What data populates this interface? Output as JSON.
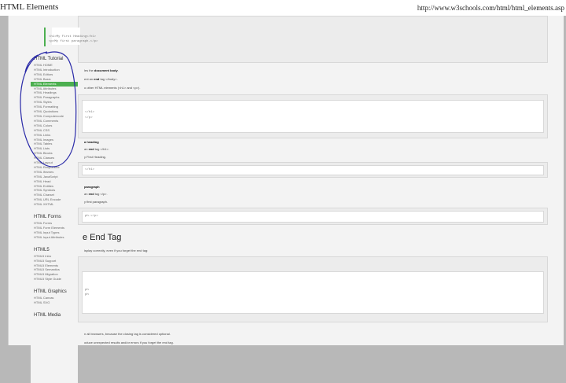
{
  "window": {
    "title": "HTML Elements",
    "url": "http://www.w3schools.com/html/html_elements.asp"
  },
  "sidebar": {
    "sections": [
      {
        "title": "HTML Tutorial",
        "items": [
          "HTML HOME",
          "HTML Introduction",
          "HTML Editors",
          "HTML Basic",
          "HTML Elements",
          "HTML Attributes",
          "HTML Headings",
          "HTML Paragraphs",
          "HTML Styles",
          "HTML Formatting",
          "HTML Quotations",
          "HTML Computercode",
          "HTML Comments",
          "HTML Colors",
          "HTML CSS",
          "HTML Links",
          "HTML Images",
          "HTML Tables",
          "HTML Lists",
          "HTML Blocks",
          "HTML Classes",
          "HTML Layout",
          "HTML Responsive",
          "HTML Iframes",
          "HTML JavaScript",
          "HTML Head",
          "HTML Entities",
          "HTML Symbols",
          "HTML Charset",
          "HTML URL Encode",
          "HTML XHTML"
        ]
      },
      {
        "title": "HTML Forms",
        "items": [
          "HTML Forms",
          "HTML Form Elements",
          "HTML Input Types",
          "HTML Input Attributes"
        ]
      },
      {
        "title": "HTML5",
        "items": [
          "HTML5 Intro",
          "HTML5 Support",
          "HTML5 Elements",
          "HTML5 Semantics",
          "HTML5 Migration",
          "HTML5 Style Guide"
        ]
      },
      {
        "title": "HTML Graphics",
        "items": [
          "HTML Canvas",
          "HTML SVG"
        ]
      },
      {
        "title": "HTML Media",
        "items": []
      }
    ],
    "active_item": "HTML Elements"
  },
  "main": {
    "code1": [
      "<h1>My First Heading</h1>",
      "<p>My first paragraph.</p>"
    ],
    "text1a_pre": "les the ",
    "text1a_bold": "document body",
    "text1a_post": ".",
    "text1b_pre": "ent an ",
    "text1b_bold": "end",
    "text1b_post": " tag </body>.",
    "text1c": "o other HTML elements (<h1> and <p>).",
    "code2": [
      "</h1>",
      "</p>"
    ],
    "text2a_bold": "a heading",
    "text2b_pre": "an ",
    "text2b_bold": "end",
    "text2b_post": " tag </h1>.",
    "text2c": "y First Heading.",
    "code3": [
      "</h1>"
    ],
    "text3a_bold": "paragraph",
    "text3b_pre": "an ",
    "text3b_bold": "end",
    "text3b_post": " tag </p>.",
    "text3c": "y first paragraph.",
    "code4": [
      "ph.</p>"
    ],
    "heading": "e End Tag",
    "text4": "isplay correctly, even if you forget the end tag:",
    "code5": [
      "ph",
      "ph"
    ],
    "text5a": "n all browsers, because the closing tag is considered optional.",
    "text5b": "oduce unexpected results and/or errors if you forget the end tag."
  },
  "annotation": {
    "color": "#2a2aa8"
  }
}
